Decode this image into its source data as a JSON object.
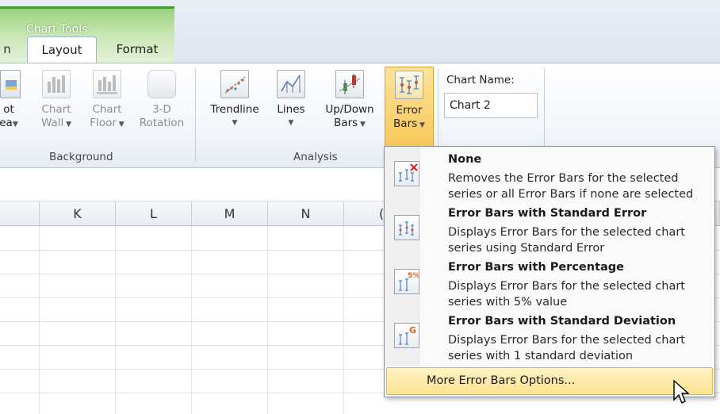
{
  "ribbon_context": {
    "title": "Chart Tools"
  },
  "tabs": {
    "cut_left": "n",
    "layout": "Layout",
    "format": "Format"
  },
  "background_group": {
    "cut_button": {
      "line1": "ot",
      "line2": "ea"
    },
    "chart_wall": {
      "line1": "Chart",
      "line2": "Wall"
    },
    "chart_floor": {
      "line1": "Chart",
      "line2": "Floor"
    },
    "rotation": {
      "line1": "3-D",
      "line2": "Rotation"
    },
    "label": "Background"
  },
  "analysis_group": {
    "trendline": "Trendline",
    "lines": "Lines",
    "updown": {
      "line1": "Up/Down",
      "line2": "Bars"
    },
    "error_bars": {
      "line1": "Error",
      "line2": "Bars"
    },
    "label": "Analysis"
  },
  "chart_name": {
    "label": "Chart Name:",
    "value": "Chart 2"
  },
  "columns": [
    "K",
    "L",
    "M",
    "N",
    "("
  ],
  "menu": {
    "items": [
      {
        "title": "None",
        "desc": "Removes the Error Bars for the selected series or all Error Bars if none are selected",
        "icon": "error-bars-none-icon"
      },
      {
        "title": "Error Bars with Standard Error",
        "desc": "Displays Error Bars for the selected chart series using Standard Error",
        "icon": "error-bars-standard-error-icon"
      },
      {
        "title": "Error Bars with Percentage",
        "desc": "Displays Error Bars for the selected chart series with 5% value",
        "icon": "error-bars-percentage-icon",
        "badge": "5%"
      },
      {
        "title": "Error Bars with Standard Deviation",
        "desc": "Displays Error Bars for the selected chart series with 1 standard deviation",
        "icon": "error-bars-std-dev-icon",
        "badge": "G"
      }
    ],
    "more_options": "More Error Bars Options..."
  },
  "colors": {
    "accent_green": "#3f9b2e",
    "highlight": "#fde28f",
    "badge_orange": "#e0641e"
  }
}
